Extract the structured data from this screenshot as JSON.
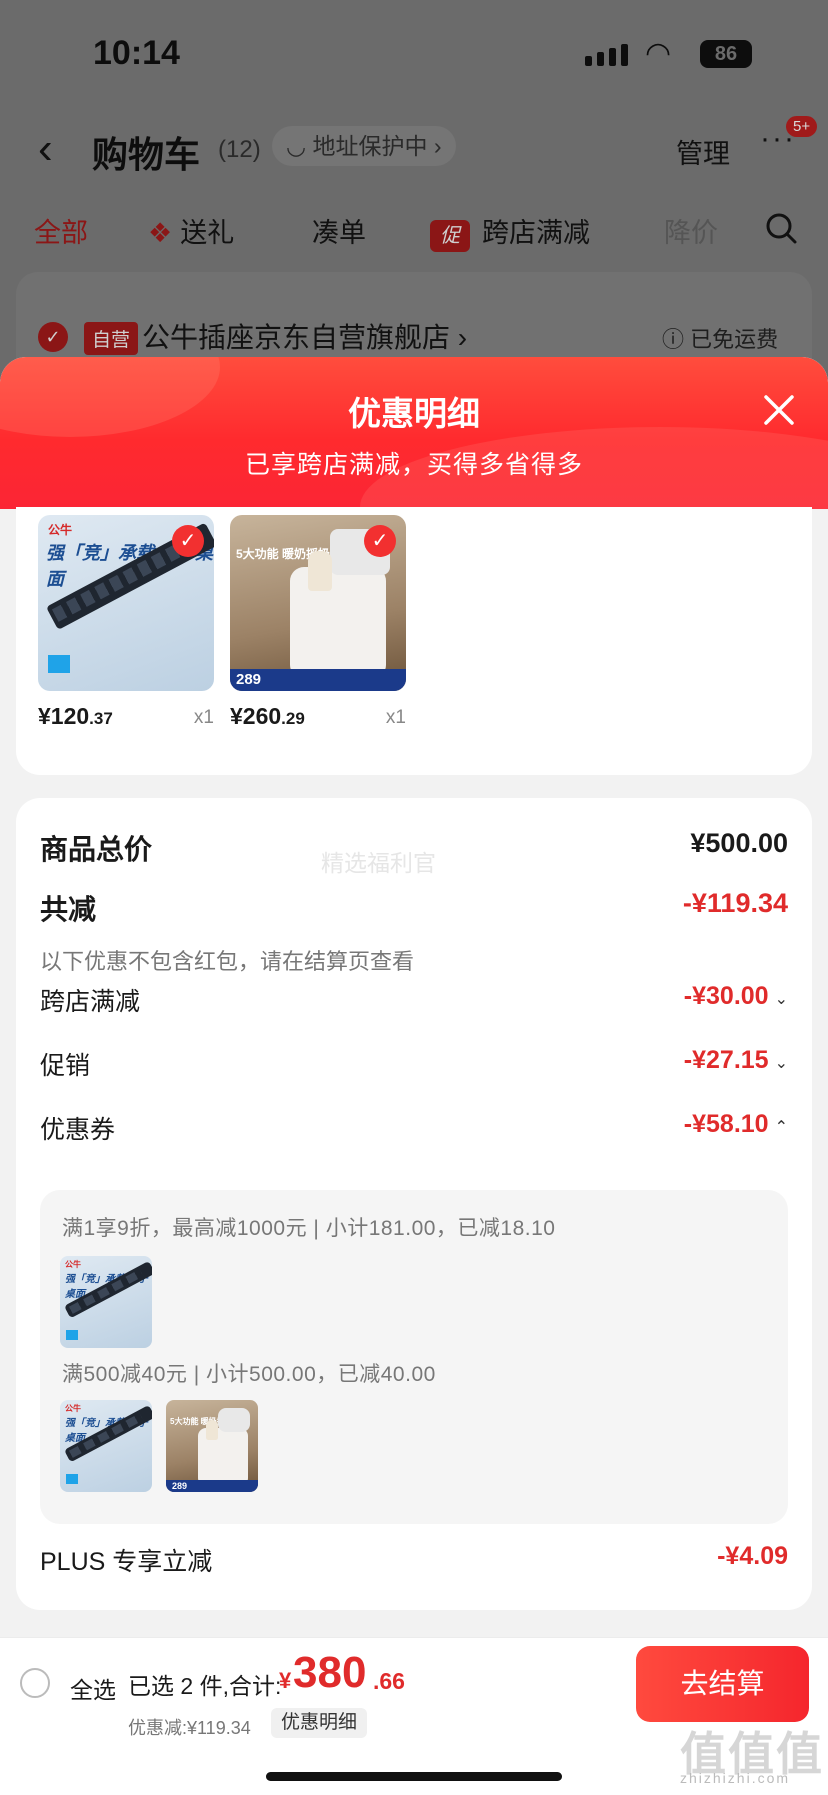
{
  "status_bar": {
    "time": "10:14",
    "battery": "86"
  },
  "nav": {
    "title": "购物车",
    "count": "(12)",
    "address": "地址保护中",
    "manage": "管理",
    "badge": "5+"
  },
  "tabs": [
    {
      "label": "全部"
    },
    {
      "label": "送礼"
    },
    {
      "label": "凑单"
    },
    {
      "label": "跨店满减",
      "tag": "促"
    },
    {
      "label": "降价"
    }
  ],
  "shop": {
    "tag": "自营",
    "name": "公牛插座京东自营旗舰店",
    "shipping": "已免运费"
  },
  "sheet": {
    "title": "优惠明细",
    "subtitle": "已享跨店满减，买得多省得多"
  },
  "products": [
    {
      "price_main": "¥120",
      "price_decimal": ".37",
      "qty": "x1",
      "thumb_brand": "公牛",
      "thumb_slogan": "强「竞」承载 隐于桌面"
    },
    {
      "price_main": "¥260",
      "price_decimal": ".29",
      "qty": "x1",
      "thumb_title": "5大功能 暖奶摇奶一体",
      "thumb_price": "289"
    }
  ],
  "summary": {
    "watermark": "精选福利官",
    "total_label": "商品总价",
    "total_value": "¥500.00",
    "reduce_label": "共减",
    "reduce_value": "-¥119.34",
    "note": "以下优惠不包含红包，请在结算页查看",
    "items": [
      {
        "label": "跨店满减",
        "value": "-¥30.00",
        "chevron": "down"
      },
      {
        "label": "促销",
        "value": "-¥27.15",
        "chevron": "down"
      },
      {
        "label": "优惠券",
        "value": "-¥58.10",
        "chevron": "up"
      }
    ],
    "coupons": [
      {
        "text": "满1享9折，最高减1000元 | 小计181.00，已减18.10"
      },
      {
        "text": "满500减40元 | 小计500.00，已减40.00"
      }
    ],
    "plus_label": "PLUS 专享立减",
    "plus_value": "-¥4.09"
  },
  "bottom": {
    "select_all": "全选",
    "selected": "已选 2 件,合计:",
    "yen": "¥",
    "total_int": "380",
    "total_dec": ".66",
    "discount": "优惠减:¥119.34",
    "detail": "优惠明细",
    "checkout": "去结算",
    "watermark": "值值值",
    "watermark_url": "zhizhizhi.com"
  },
  "colors": {
    "accent": "#f5262d",
    "price_red": "#e02b2b"
  }
}
